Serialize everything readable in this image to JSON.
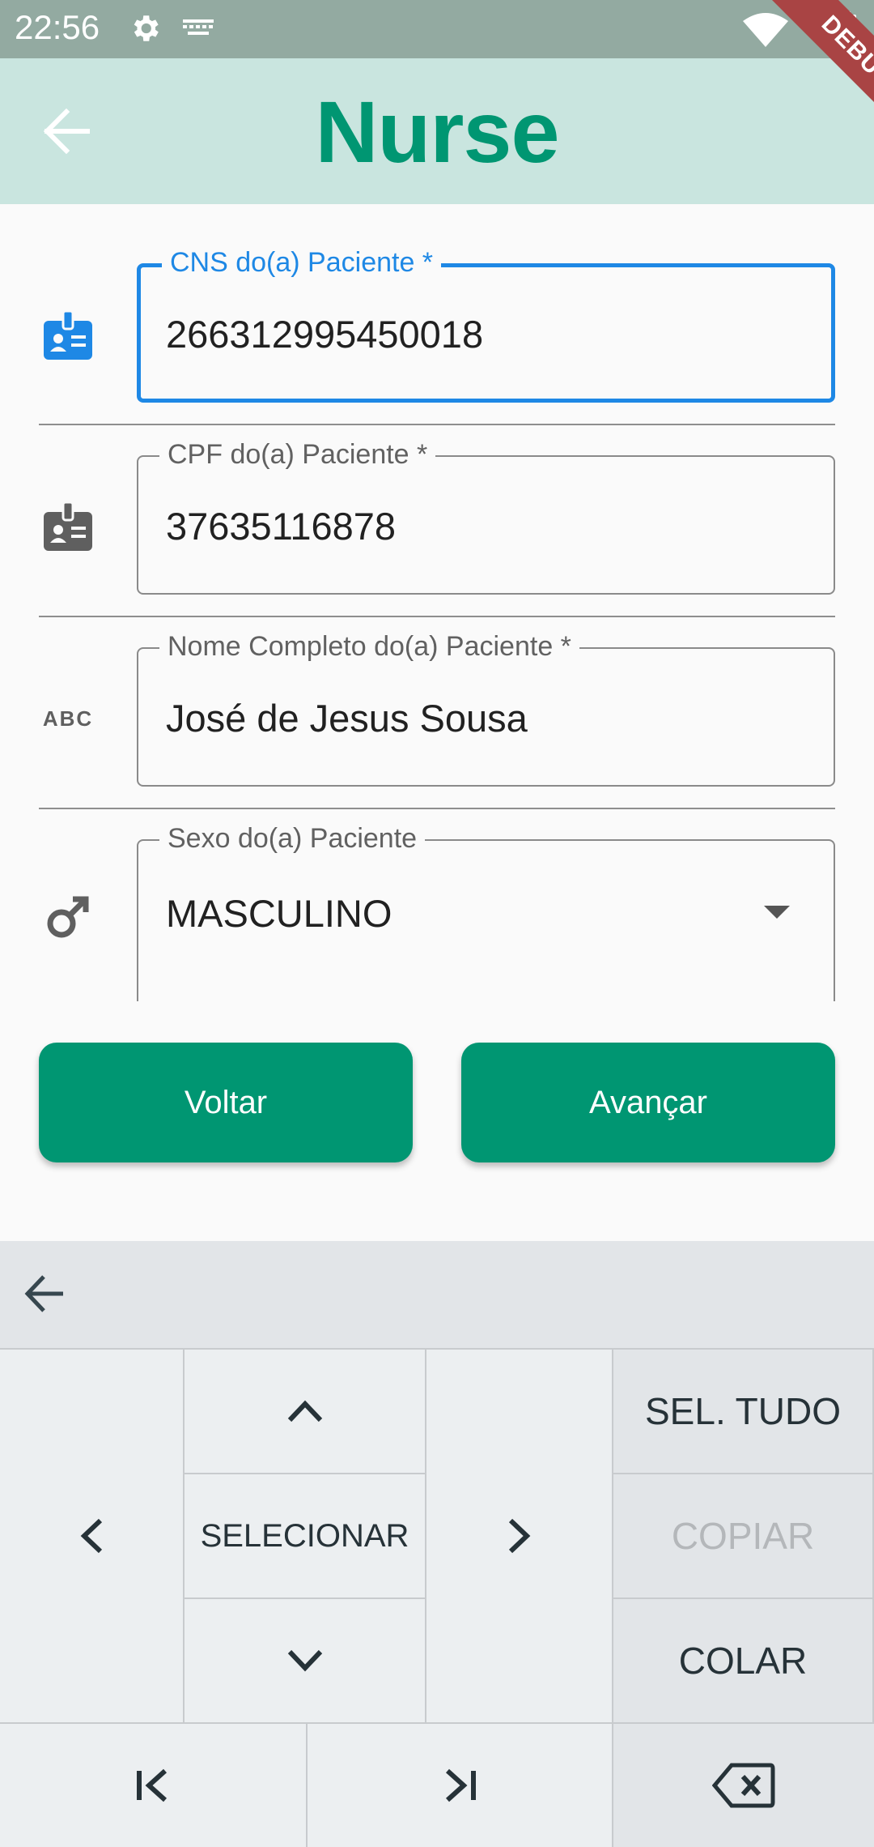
{
  "status_bar": {
    "time": "22:56"
  },
  "app_bar": {
    "title": "Nurse",
    "debug_banner": "DEBUG"
  },
  "form": {
    "cns": {
      "label": "CNS do(a) Paciente *",
      "value": "266312995450018"
    },
    "cpf": {
      "label": "CPF do(a) Paciente *",
      "value": "37635116878"
    },
    "nome": {
      "label": "Nome Completo do(a) Paciente *",
      "value": "José de Jesus Sousa"
    },
    "sexo": {
      "label": "Sexo do(a) Paciente",
      "value": "MASCULINO"
    },
    "name_icon_text": "ABC"
  },
  "buttons": {
    "back": "Voltar",
    "next": "Avançar"
  },
  "keyboard": {
    "select": "SELECIONAR",
    "select_all": "SEL. TUDO",
    "copy": "COPIAR",
    "paste": "COLAR"
  },
  "colors": {
    "accent": "#009672",
    "focus": "#1e88e5",
    "app_bar_bg": "#c9e5df",
    "status_bar_bg": "#93aaa1"
  }
}
